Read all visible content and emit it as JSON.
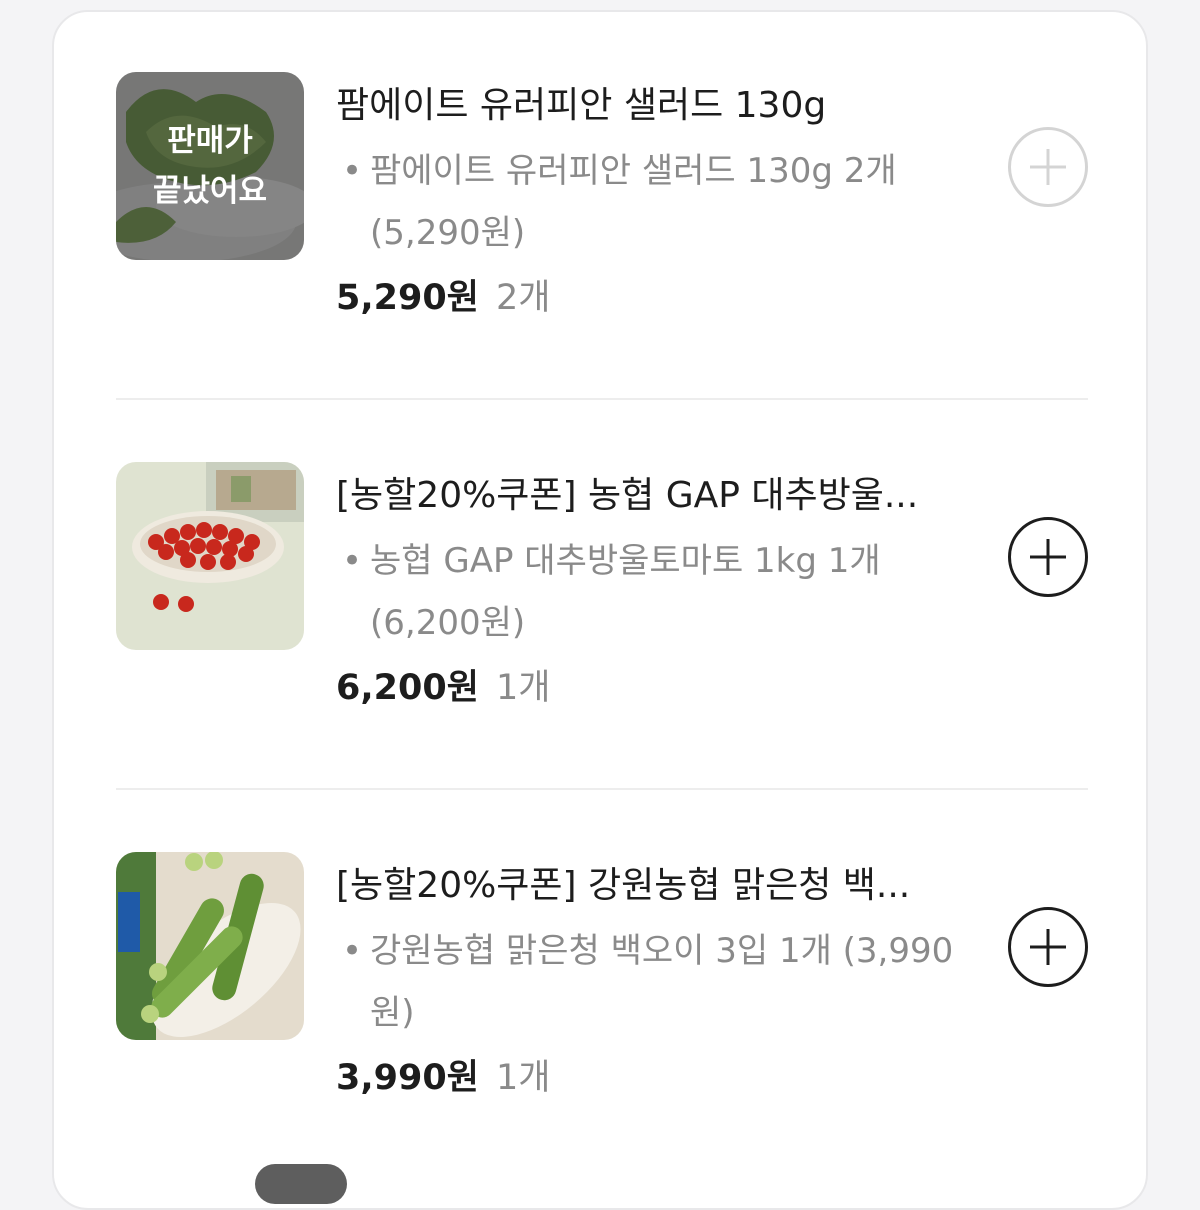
{
  "items": [
    {
      "title": "팜에이트 유러피안 샐러드 130g",
      "option_bullet": "•",
      "option": "팜에이트 유러피안 샐러드 130g 2개 (5,290원)",
      "price": "5,290원",
      "qty": "2개",
      "sold_out_label_line1": "판매가",
      "sold_out_label_line2": "끝났어요",
      "sold_out": true,
      "add_icon": "plus-circle-icon",
      "image": "salad-photo"
    },
    {
      "title": "[농할20%쿠폰] 농협 GAP 대추방울...",
      "option_bullet": "•",
      "option": "농협 GAP 대추방울토마토 1kg 1개 (6,200원)",
      "price": "6,200원",
      "qty": "1개",
      "sold_out": false,
      "add_icon": "plus-circle-icon",
      "image": "cherry-tomato-photo"
    },
    {
      "title": "[농할20%쿠폰] 강원농협 맑은청 백...",
      "option_bullet": "•",
      "option": "강원농협 맑은청 백오이 3입 1개 (3,990원)",
      "price": "3,990원",
      "qty": "1개",
      "sold_out": false,
      "add_icon": "plus-circle-icon",
      "image": "cucumber-photo"
    }
  ],
  "colors": {
    "text_primary": "#1d1d1d",
    "text_secondary": "#8a8a8a",
    "divider": "#ededed",
    "disabled": "#d4d4d4"
  }
}
